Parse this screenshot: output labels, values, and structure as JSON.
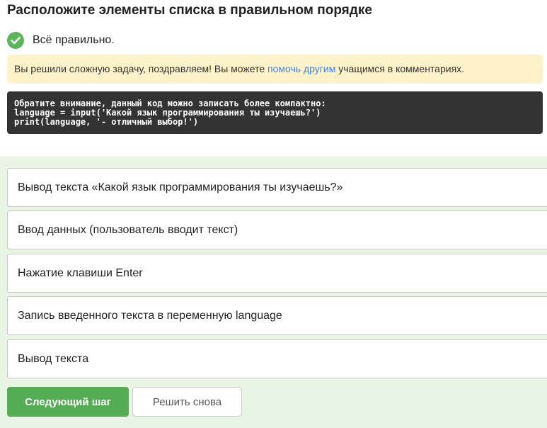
{
  "task": {
    "title": "Расположите элементы списка в правильном порядке"
  },
  "status": {
    "icon": "check-circle-icon",
    "color": "#5bb55b",
    "text": "Всё правильно."
  },
  "notice": {
    "before_link": "Вы решили сложную задачу, поздравляем! Вы можете ",
    "link_text": "помочь другим",
    "after_link": " учащимся в комментариях.",
    "background": "#fdf2c9",
    "link_color": "#3a87e8"
  },
  "code": {
    "lines": [
      "Обратите внимание, данный код можно записать более компактно:",
      "language = input('Какой язык программирования ты изучаешь?')",
      "print(language, '- отличный выбор!')"
    ]
  },
  "options": [
    "Вывод текста «Какой язык программирования ты изучаешь?»",
    "Ввод данных (пользователь вводит текст)",
    "Нажатие клавиши Enter",
    "Запись введенного текста в переменную language",
    "Вывод текста"
  ],
  "buttons": {
    "next_label": "Следующий шаг",
    "retry_label": "Решить снова",
    "accent": "#54ad54"
  }
}
